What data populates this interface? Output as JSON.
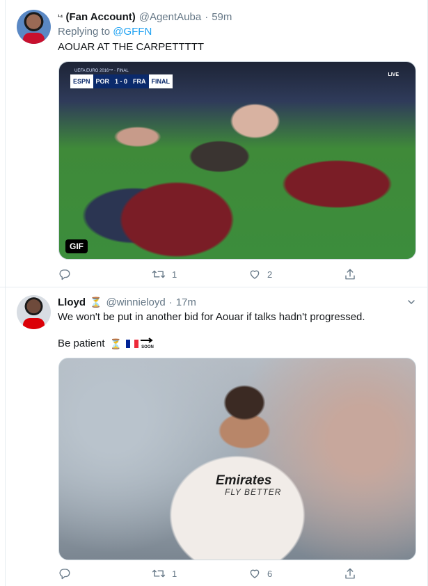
{
  "tweets": [
    {
      "name": "(Fan Account)",
      "name_prefix": "¹⁴",
      "handle": "@AgentAuba",
      "time": "59m",
      "reply_label": "Replying to",
      "reply_to": "@GFFN",
      "text": "AOUAR AT THE CARPETTTTT",
      "media": {
        "type": "gif",
        "badge": "GIF",
        "scoreboard": {
          "competition": "UEFA EURO 2016™ · FINAL",
          "brand": "ESPN",
          "home": "POR",
          "score": "1 - 0",
          "away": "FRA",
          "stage": "FINAL"
        },
        "live": "LIVE"
      },
      "actions": {
        "reply": "",
        "retweet": "1",
        "like": "2"
      }
    },
    {
      "name": "Lloyd",
      "handle": "@winnieloyd",
      "time": "17m",
      "text_line1": "We won't be put in another bid for Aouar if talks hadn't progressed.",
      "text_line2": "Be patient",
      "soon_label": "SOON",
      "media": {
        "type": "photo",
        "sponsor": "Emirates",
        "sponsor_sub": "FLY BETTER"
      },
      "actions": {
        "reply": "",
        "retweet": "1",
        "like": "6"
      }
    }
  ],
  "colors": {
    "accent": "#1da1f2",
    "muted": "#657786",
    "border": "#e6ecf0"
  }
}
